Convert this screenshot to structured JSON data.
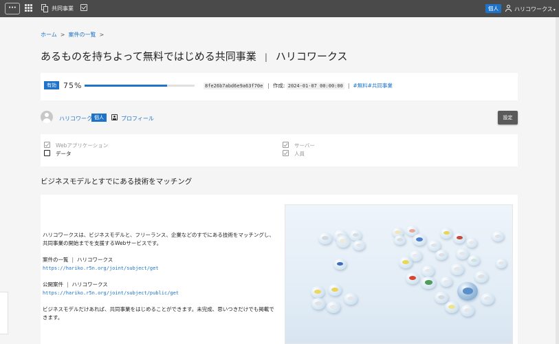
{
  "topbar": {
    "menu_label": "···",
    "app_label": "共同事業",
    "badge": "個人",
    "user": "ハリコワークス",
    "caret": "▾"
  },
  "breadcrumb": {
    "home": "ホーム",
    "list": "案件の一覧",
    "sep": ">"
  },
  "title": {
    "main": "あるものを持ちよって無料ではじめる共同事業",
    "sep": "|",
    "owner": "ハリコワークス"
  },
  "status": {
    "badge": "有効",
    "percent_text": "75%",
    "progress": 0.75,
    "hash": "8fe26b7abd6e9a63f70e",
    "created_label": "作成:",
    "created": "2024-01-07 00:00:00",
    "tags": "#無料#共同事業"
  },
  "owner": {
    "name": "ハリコワークス",
    "badge": "個人",
    "profile_link": "プロフィール",
    "settings": "設定"
  },
  "categories": [
    {
      "label": "Webアプリケーション",
      "checked": true,
      "dim": true
    },
    {
      "label": "データ",
      "checked": false,
      "dim": false
    },
    {
      "label": "サーバー",
      "checked": true,
      "dim": true
    },
    {
      "label": "人員",
      "checked": true,
      "dim": true
    }
  ],
  "section": {
    "heading": "ビジネスモデルとすでにある技術をマッチング"
  },
  "description": {
    "intro": "ハリコワークスは、ビジネスモデルと、フリーランス、企業などのすでにある技術をマッチングし、共同事業の開始までを支援するWebサービスです。",
    "link1_label": "案件の一覧",
    "link1_owner": "ハリコワークス",
    "link1_url": "https://hariko.r5n.org/joint/subject/get",
    "link2_label": "公開案件",
    "link2_owner": "ハリコワークス",
    "link2_url": "https://hariko.r5n.org/joint/subject/public/get",
    "closing": "ビジネスモデルだけあれば、共同事業をはじめることができます。未完成、思いつきだけでも掲載できます。",
    "pipe": "|"
  },
  "colors": {
    "accent": "#1e73c9",
    "topbar": "#4a4a4a",
    "button": "#5a5a5a"
  },
  "icons": [
    "menu-icon",
    "apps-grid-icon",
    "copy-icon",
    "checkbox-icon",
    "user-icon",
    "profile-card-icon"
  ]
}
